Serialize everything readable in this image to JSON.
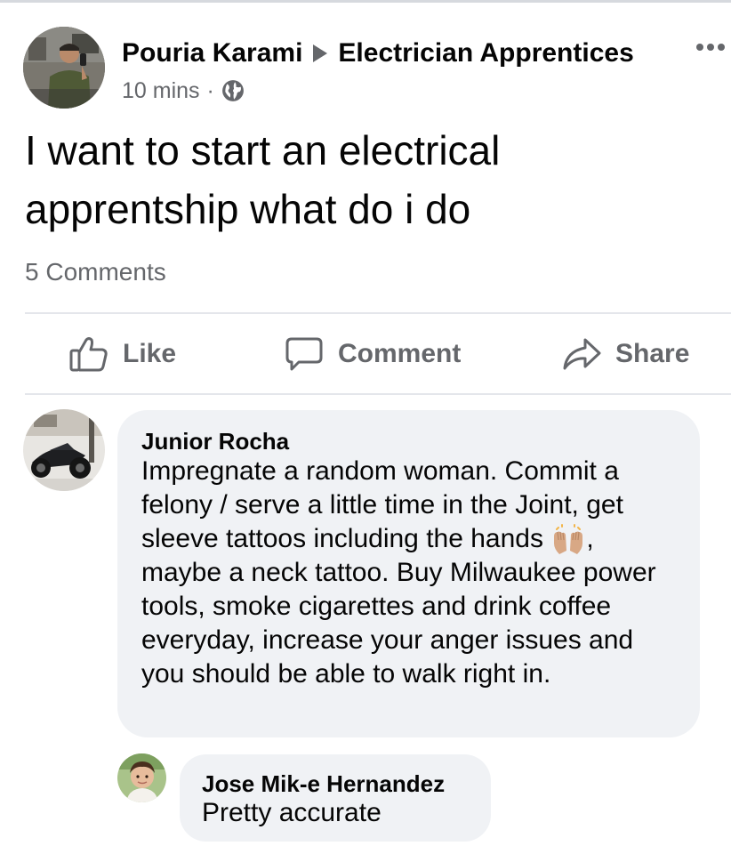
{
  "post": {
    "author": "Pouria Karami",
    "group": "Electrician Apprentices",
    "time": "10 mins",
    "separator": "·",
    "privacy_icon": "globe-icon",
    "text": "I want to start an electrical apprentship what do i do",
    "comment_count": "5 Comments"
  },
  "actions": {
    "like": "Like",
    "comment": "Comment",
    "share": "Share"
  },
  "comments": [
    {
      "name": "Junior Rocha",
      "text_before_emoji": "Impregnate a random woman. Commit a felony / serve a little time in the Joint, get sleeve tattoos including the hands ",
      "emoji": "raising-hands-emoji",
      "text_after_emoji": ", maybe a neck tattoo. Buy Milwaukee power tools, smoke cigarettes and drink coffee everyday, increase your anger issues and you should be able to walk right in."
    },
    {
      "name": "Jose Mik-e Hernandez",
      "text": "Pretty accurate"
    }
  ],
  "colors": {
    "text_primary": "#050505",
    "text_secondary": "#65676b",
    "bubble_bg": "#f0f2f5",
    "divider": "#e4e6eb"
  }
}
